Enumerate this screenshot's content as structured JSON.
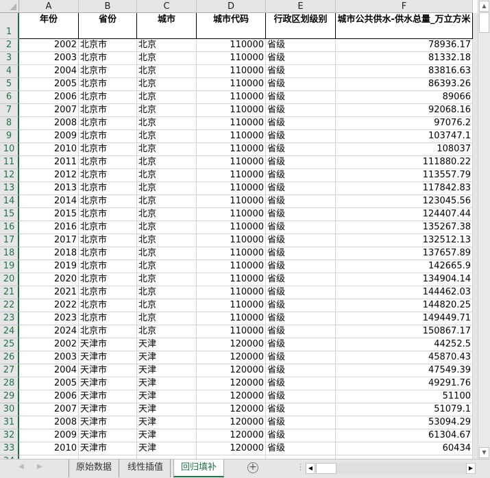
{
  "columns": [
    "A",
    "B",
    "C",
    "D",
    "E",
    "F"
  ],
  "header": [
    "年份",
    "省份",
    "城市",
    "城市代码",
    "行政区划级别",
    "城市公共供水-供水总量_万立方米"
  ],
  "rows": [
    [
      "2002",
      "北京市",
      "北京",
      "110000",
      "省级",
      "78936.17"
    ],
    [
      "2003",
      "北京市",
      "北京",
      "110000",
      "省级",
      "81332.18"
    ],
    [
      "2004",
      "北京市",
      "北京",
      "110000",
      "省级",
      "83816.63"
    ],
    [
      "2005",
      "北京市",
      "北京",
      "110000",
      "省级",
      "86393.26"
    ],
    [
      "2006",
      "北京市",
      "北京",
      "110000",
      "省级",
      "89066"
    ],
    [
      "2007",
      "北京市",
      "北京",
      "110000",
      "省级",
      "92068.16"
    ],
    [
      "2008",
      "北京市",
      "北京",
      "110000",
      "省级",
      "97076.2"
    ],
    [
      "2009",
      "北京市",
      "北京",
      "110000",
      "省级",
      "103747.1"
    ],
    [
      "2010",
      "北京市",
      "北京",
      "110000",
      "省级",
      "108037"
    ],
    [
      "2011",
      "北京市",
      "北京",
      "110000",
      "省级",
      "111880.22"
    ],
    [
      "2012",
      "北京市",
      "北京",
      "110000",
      "省级",
      "113557.79"
    ],
    [
      "2013",
      "北京市",
      "北京",
      "110000",
      "省级",
      "117842.83"
    ],
    [
      "2014",
      "北京市",
      "北京",
      "110000",
      "省级",
      "123045.56"
    ],
    [
      "2015",
      "北京市",
      "北京",
      "110000",
      "省级",
      "124407.44"
    ],
    [
      "2016",
      "北京市",
      "北京",
      "110000",
      "省级",
      "135267.38"
    ],
    [
      "2017",
      "北京市",
      "北京",
      "110000",
      "省级",
      "132512.13"
    ],
    [
      "2018",
      "北京市",
      "北京",
      "110000",
      "省级",
      "137657.89"
    ],
    [
      "2019",
      "北京市",
      "北京",
      "110000",
      "省级",
      "142665.9"
    ],
    [
      "2020",
      "北京市",
      "北京",
      "110000",
      "省级",
      "134904.14"
    ],
    [
      "2021",
      "北京市",
      "北京",
      "110000",
      "省级",
      "144462.03"
    ],
    [
      "2022",
      "北京市",
      "北京",
      "110000",
      "省级",
      "144820.25"
    ],
    [
      "2023",
      "北京市",
      "北京",
      "110000",
      "省级",
      "149449.71"
    ],
    [
      "2024",
      "北京市",
      "北京",
      "110000",
      "省级",
      "150867.17"
    ],
    [
      "2002",
      "天津市",
      "天津",
      "120000",
      "省级",
      "44252.5"
    ],
    [
      "2003",
      "天津市",
      "天津",
      "120000",
      "省级",
      "45870.43"
    ],
    [
      "2004",
      "天津市",
      "天津",
      "120000",
      "省级",
      "47549.39"
    ],
    [
      "2005",
      "天津市",
      "天津",
      "120000",
      "省级",
      "49291.76"
    ],
    [
      "2006",
      "天津市",
      "天津",
      "120000",
      "省级",
      "51100"
    ],
    [
      "2007",
      "天津市",
      "天津",
      "120000",
      "省级",
      "51079.1"
    ],
    [
      "2008",
      "天津市",
      "天津",
      "120000",
      "省级",
      "53094.29"
    ],
    [
      "2009",
      "天津市",
      "天津",
      "120000",
      "省级",
      "61304.67"
    ],
    [
      "2010",
      "天津市",
      "天津",
      "120000",
      "省级",
      "60434"
    ]
  ],
  "tabs": [
    "原始数据",
    "线性插值",
    "回归填补"
  ],
  "active_tab": 2,
  "accent": "#217346"
}
